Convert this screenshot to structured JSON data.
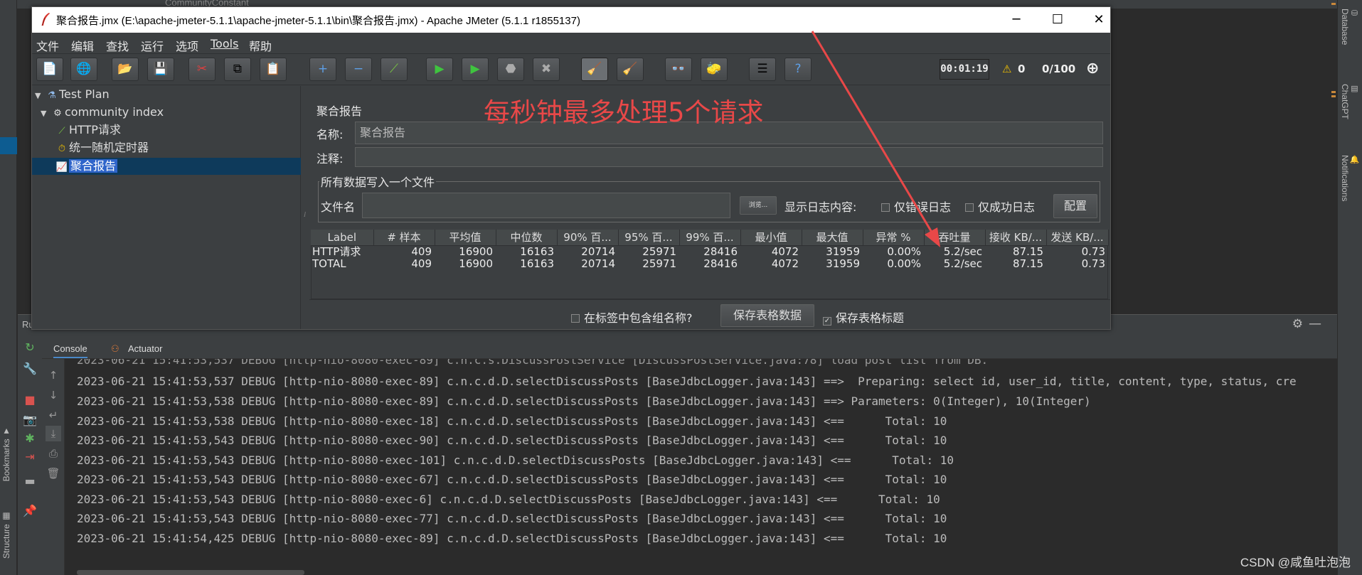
{
  "ide": {
    "top_tab": "CommunityConstant",
    "right_tabs": [
      "Database",
      "ChatGPT",
      "Notifications"
    ],
    "left_tabs": [
      "Bookmarks",
      "Structure"
    ],
    "run_label": "Ru",
    "console_tabs": [
      {
        "label": "Console"
      },
      {
        "label": "Actuator"
      }
    ],
    "log_lines": [
      "2023-06-21 15:41:53,537 DEBUG [http-nio-8080-exec-89] c.n.c.d.D.selectDiscussPosts [BaseJdbcLogger.java:143] ==>  Preparing: select id, user_id, title, content, type, status, cre",
      "2023-06-21 15:41:53,538 DEBUG [http-nio-8080-exec-89] c.n.c.d.D.selectDiscussPosts [BaseJdbcLogger.java:143] ==> Parameters: 0(Integer), 10(Integer)",
      "2023-06-21 15:41:53,538 DEBUG [http-nio-8080-exec-18] c.n.c.d.D.selectDiscussPosts [BaseJdbcLogger.java:143] <==      Total: 10",
      "2023-06-21 15:41:53,543 DEBUG [http-nio-8080-exec-90] c.n.c.d.D.selectDiscussPosts [BaseJdbcLogger.java:143] <==      Total: 10",
      "2023-06-21 15:41:53,543 DEBUG [http-nio-8080-exec-101] c.n.c.d.D.selectDiscussPosts [BaseJdbcLogger.java:143] <==      Total: 10",
      "2023-06-21 15:41:53,543 DEBUG [http-nio-8080-exec-67] c.n.c.d.D.selectDiscussPosts [BaseJdbcLogger.java:143] <==      Total: 10",
      "2023-06-21 15:41:53,543 DEBUG [http-nio-8080-exec-6] c.n.c.d.D.selectDiscussPosts [BaseJdbcLogger.java:143] <==      Total: 10",
      "2023-06-21 15:41:53,543 DEBUG [http-nio-8080-exec-77] c.n.c.d.D.selectDiscussPosts [BaseJdbcLogger.java:143] <==      Total: 10",
      "2023-06-21 15:41:54,425 DEBUG [http-nio-8080-exec-89] c.n.c.d.D.selectDiscussPosts [BaseJdbcLogger.java:143] <==      Total: 10"
    ],
    "watermark": "CSDN @咸鱼吐泡泡"
  },
  "jmeter": {
    "title": "聚合报告.jmx (E:\\apache-jmeter-5.1.1\\apache-jmeter-5.1.1\\bin\\聚合报告.jmx) - Apache JMeter (5.1.1 r1855137)",
    "window_controls": {
      "minimize": "─",
      "maximize": "☐",
      "close": "✕"
    },
    "menu": [
      "文件",
      "编辑",
      "查找",
      "运行",
      "选项",
      "Tools",
      "帮助"
    ],
    "toolbar_status": {
      "timer": "00:01:19",
      "warnings": "0",
      "threads": "0/100"
    },
    "tree": [
      {
        "label": "Test Plan",
        "icon": "flask-icon"
      },
      {
        "label": "community index",
        "icon": "gear-icon"
      },
      {
        "label": "HTTP请求",
        "icon": "pipette-icon"
      },
      {
        "label": "统一随机定时器",
        "icon": "stopwatch-icon"
      },
      {
        "label": "聚合报告",
        "icon": "chart-icon"
      }
    ],
    "panel": {
      "title": "聚合报告",
      "name_label": "名称:",
      "name_value": "聚合报告",
      "comment_label": "注释:",
      "comment_value": "",
      "file_group_title": "所有数据写入一个文件",
      "file_label": "文件名",
      "file_value": "",
      "browse_label": "浏览...",
      "log_display_label": "显示日志内容:",
      "errors_only_label": "仅错误日志",
      "success_only_label": "仅成功日志",
      "config_label": "配置",
      "include_group_label": "在标签中包含组名称?",
      "save_table_label": "保存表格数据",
      "save_header_label": "保存表格标题"
    },
    "table": {
      "headers": [
        "Label",
        "# 样本",
        "平均值",
        "中位数",
        "90% 百...",
        "95% 百...",
        "99% 百...",
        "最小值",
        "最大值",
        "异常 %",
        "吞吐量",
        "接收 KB/...",
        "发送 KB/..."
      ],
      "rows": [
        [
          "HTTP请求",
          "409",
          "16900",
          "16163",
          "20714",
          "25971",
          "28416",
          "4072",
          "31959",
          "0.00%",
          "5.2/sec",
          "87.15",
          "0.73"
        ],
        [
          "TOTAL",
          "409",
          "16900",
          "16163",
          "20714",
          "25971",
          "28416",
          "4072",
          "31959",
          "0.00%",
          "5.2/sec",
          "87.15",
          "0.73"
        ]
      ]
    },
    "annotation": "每秒钟最多处理5个请求"
  },
  "colors": {
    "annotation": "#e84848",
    "selection": "#2f65ca",
    "jmeter_bg": "#3c3f41"
  }
}
